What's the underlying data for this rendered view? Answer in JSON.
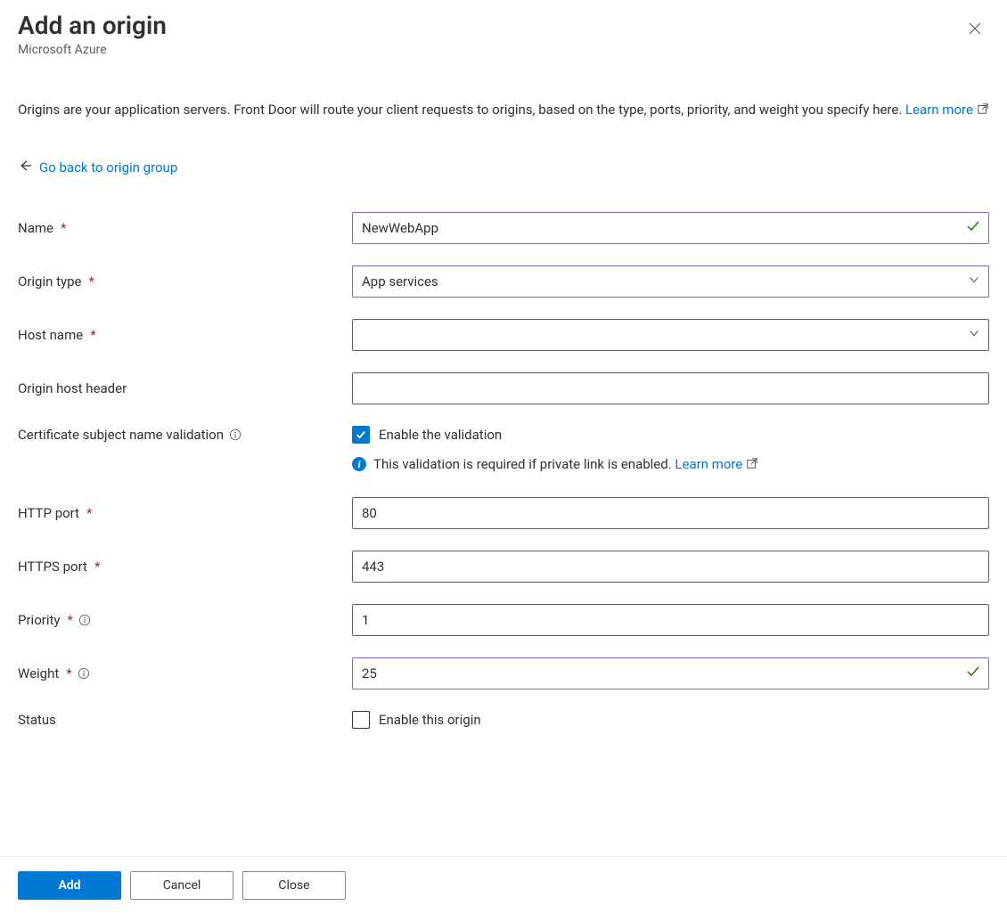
{
  "header": {
    "title": "Add an origin",
    "subtitle": "Microsoft Azure"
  },
  "description": {
    "text": "Origins are your application servers. Front Door will route your client requests to origins, based on the type, ports, priority, and weight you specify here. ",
    "learn_more": "Learn more"
  },
  "back_link": "Go back to origin group",
  "form": {
    "name": {
      "label": "Name",
      "value": "NewWebApp"
    },
    "origin_type": {
      "label": "Origin type",
      "value": "App services"
    },
    "host_name": {
      "label": "Host name",
      "value": ""
    },
    "origin_host_header": {
      "label": "Origin host header",
      "value": ""
    },
    "cert_validation": {
      "label": "Certificate subject name validation",
      "checkbox_label": "Enable the validation",
      "checked": true,
      "info_text": "This validation is required if private link is enabled. ",
      "info_learn_more": "Learn more"
    },
    "http_port": {
      "label": "HTTP port",
      "value": "80"
    },
    "https_port": {
      "label": "HTTPS port",
      "value": "443"
    },
    "priority": {
      "label": "Priority",
      "value": "1"
    },
    "weight": {
      "label": "Weight",
      "value": "25"
    },
    "status": {
      "label": "Status",
      "checkbox_label": "Enable this origin",
      "checked": false
    }
  },
  "footer": {
    "add": "Add",
    "cancel": "Cancel",
    "close": "Close"
  }
}
